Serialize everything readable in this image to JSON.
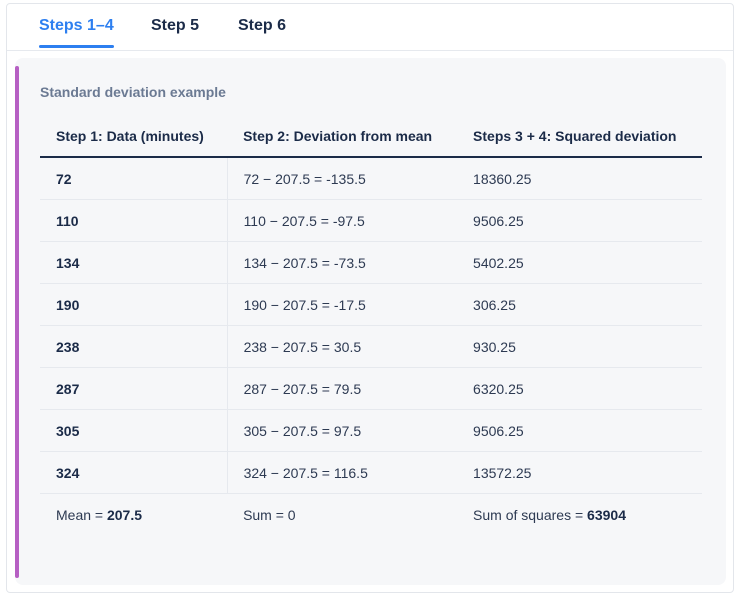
{
  "tabs": [
    {
      "label": "Steps 1–4",
      "active": true
    },
    {
      "label": "Step 5",
      "active": false
    },
    {
      "label": "Step 6",
      "active": false
    }
  ],
  "card": {
    "title": "Standard deviation example",
    "columns": [
      "Step 1: Data (minutes)",
      "Step 2: Deviation from mean",
      "Steps 3 + 4: Squared deviation"
    ],
    "rows": [
      [
        "72",
        "72 − 207.5 = -135.5",
        "18360.25"
      ],
      [
        "110",
        "110 − 207.5 = -97.5",
        "9506.25"
      ],
      [
        "134",
        "134 − 207.5 = -73.5",
        "5402.25"
      ],
      [
        "190",
        "190 − 207.5 = -17.5",
        "306.25"
      ],
      [
        "238",
        "238 − 207.5 = 30.5",
        "930.25"
      ],
      [
        "287",
        "287 − 207.5 = 79.5",
        "6320.25"
      ],
      [
        "305",
        "305 − 207.5 = 97.5",
        "9506.25"
      ],
      [
        "324",
        "324 − 207.5 = 116.5",
        "13572.25"
      ]
    ],
    "footer": {
      "mean_label": "Mean = ",
      "mean_value": "207.5",
      "sum_label": "Sum = 0",
      "squares_label": "Sum of squares = ",
      "squares_value": "63904"
    }
  },
  "colors": {
    "accent": "#2d7ff0",
    "bar": "#b65fc3",
    "text": "#1b2b48"
  }
}
